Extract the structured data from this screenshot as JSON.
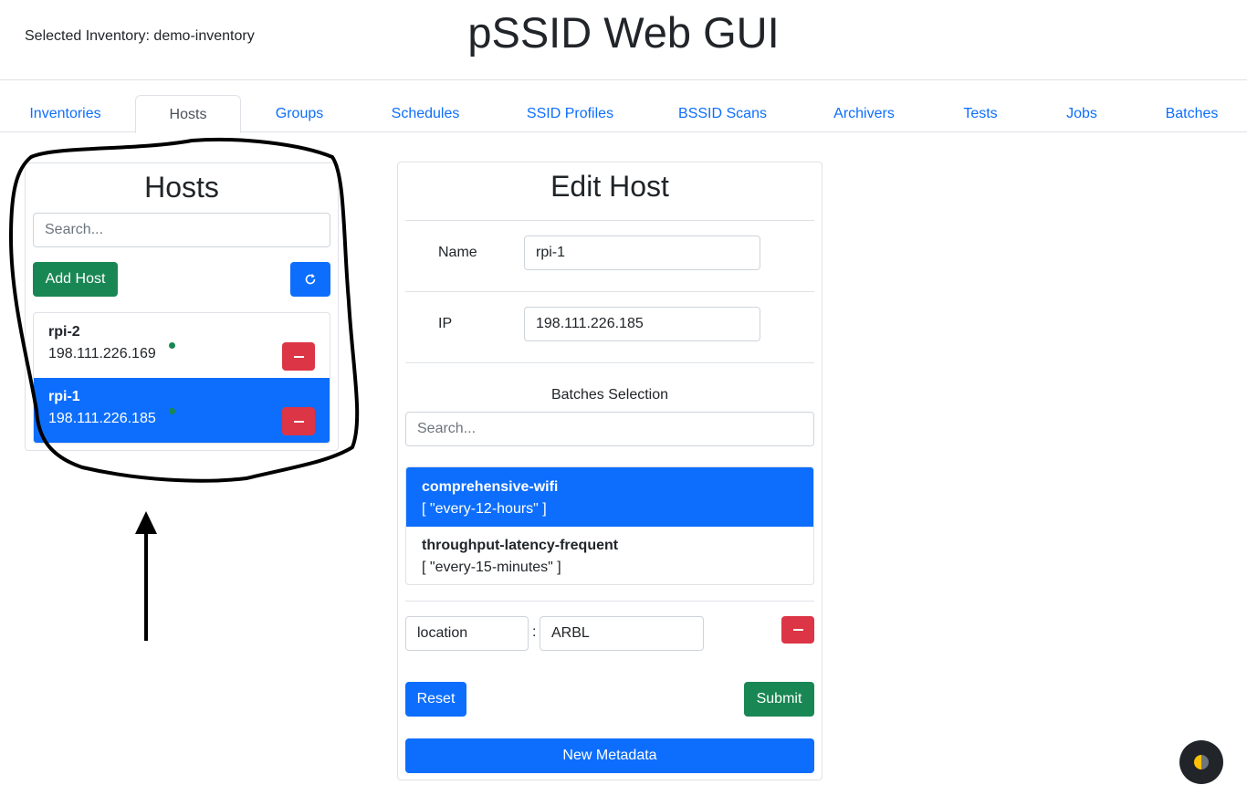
{
  "header": {
    "inventory_label": "Selected Inventory: demo-inventory",
    "title": "pSSID Web GUI"
  },
  "tabs": [
    {
      "label": "Inventories",
      "active": false
    },
    {
      "label": "Hosts",
      "active": true
    },
    {
      "label": "Groups",
      "active": false
    },
    {
      "label": "Schedules",
      "active": false
    },
    {
      "label": "SSID Profiles",
      "active": false
    },
    {
      "label": "BSSID Scans",
      "active": false
    },
    {
      "label": "Archivers",
      "active": false
    },
    {
      "label": "Tests",
      "active": false
    },
    {
      "label": "Jobs",
      "active": false
    },
    {
      "label": "Batches",
      "active": false
    }
  ],
  "hosts_panel": {
    "title": "Hosts",
    "search_placeholder": "Search...",
    "add_label": "Add Host",
    "refresh_icon": "refresh-icon",
    "items": [
      {
        "name": "rpi-2",
        "ip": "198.111.226.169",
        "status": "online",
        "selected": false
      },
      {
        "name": "rpi-1",
        "ip": "198.111.226.185",
        "status": "online",
        "selected": true
      }
    ]
  },
  "edit_host": {
    "title": "Edit Host",
    "name_label": "Name",
    "name_value": "rpi-1",
    "ip_label": "IP",
    "ip_value": "198.111.226.185",
    "batches_label": "Batches Selection",
    "batches_search_placeholder": "Search...",
    "batches": [
      {
        "name": "comprehensive-wifi",
        "schedule": "[ \"every-12-hours\" ]",
        "selected": true
      },
      {
        "name": "throughput-latency-frequent",
        "schedule": "[ \"every-15-minutes\" ]",
        "selected": false
      }
    ],
    "metadata": [
      {
        "key": "location",
        "separator": ":",
        "value": "ARBL"
      }
    ],
    "reset_label": "Reset",
    "submit_label": "Submit",
    "new_metadata_label": "New Metadata"
  },
  "theme_toggle": {
    "icon": "half-moon-icon"
  },
  "colors": {
    "primary": "#0d6efd",
    "success": "#198754",
    "danger": "#dc3545",
    "annotation": "#000000"
  }
}
